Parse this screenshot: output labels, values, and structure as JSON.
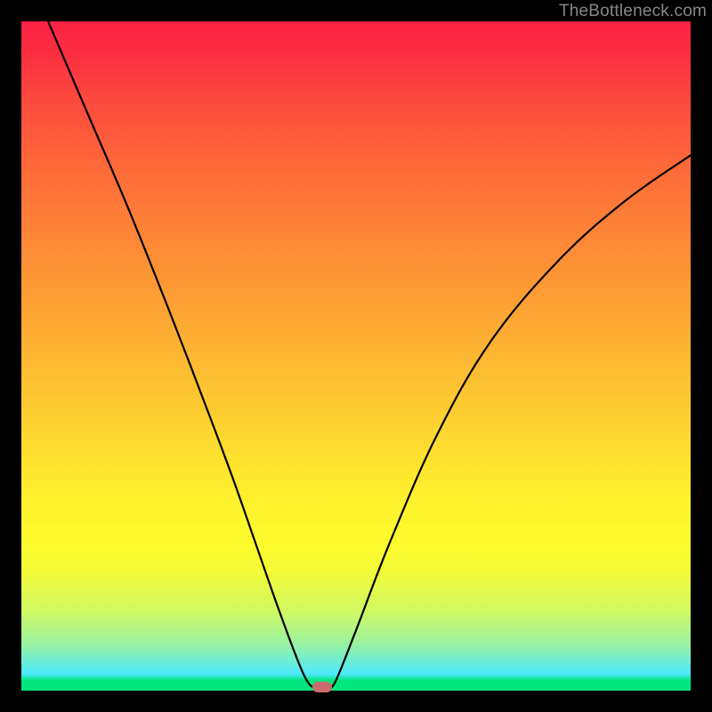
{
  "chart_data": {
    "type": "line",
    "title": "",
    "xlabel": "",
    "ylabel": "",
    "xlim": [
      0,
      100
    ],
    "ylim": [
      0,
      100
    ],
    "watermark": "TheBottleneck.com",
    "curve_left": [
      {
        "x": 4.0,
        "y": 100.0
      },
      {
        "x": 10.0,
        "y": 86.0
      },
      {
        "x": 16.0,
        "y": 72.0
      },
      {
        "x": 22.0,
        "y": 57.0
      },
      {
        "x": 27.0,
        "y": 44.0
      },
      {
        "x": 31.5,
        "y": 32.0
      },
      {
        "x": 35.0,
        "y": 22.0
      },
      {
        "x": 38.5,
        "y": 12.0
      },
      {
        "x": 41.5,
        "y": 4.0
      },
      {
        "x": 43.0,
        "y": 1.0
      },
      {
        "x": 44.0,
        "y": 0.5
      }
    ],
    "curve_right": [
      {
        "x": 46.0,
        "y": 0.5
      },
      {
        "x": 47.0,
        "y": 1.5
      },
      {
        "x": 50.0,
        "y": 9.0
      },
      {
        "x": 55.0,
        "y": 22.0
      },
      {
        "x": 62.0,
        "y": 38.0
      },
      {
        "x": 70.0,
        "y": 52.0
      },
      {
        "x": 80.0,
        "y": 64.0
      },
      {
        "x": 90.0,
        "y": 73.0
      },
      {
        "x": 100.0,
        "y": 80.0
      }
    ],
    "marker": {
      "x": 45.0,
      "y": 0.5,
      "color": "#cc6b6b"
    },
    "colors": {
      "frame": "#000000",
      "curve": "#000000",
      "watermark": "#878787"
    }
  }
}
